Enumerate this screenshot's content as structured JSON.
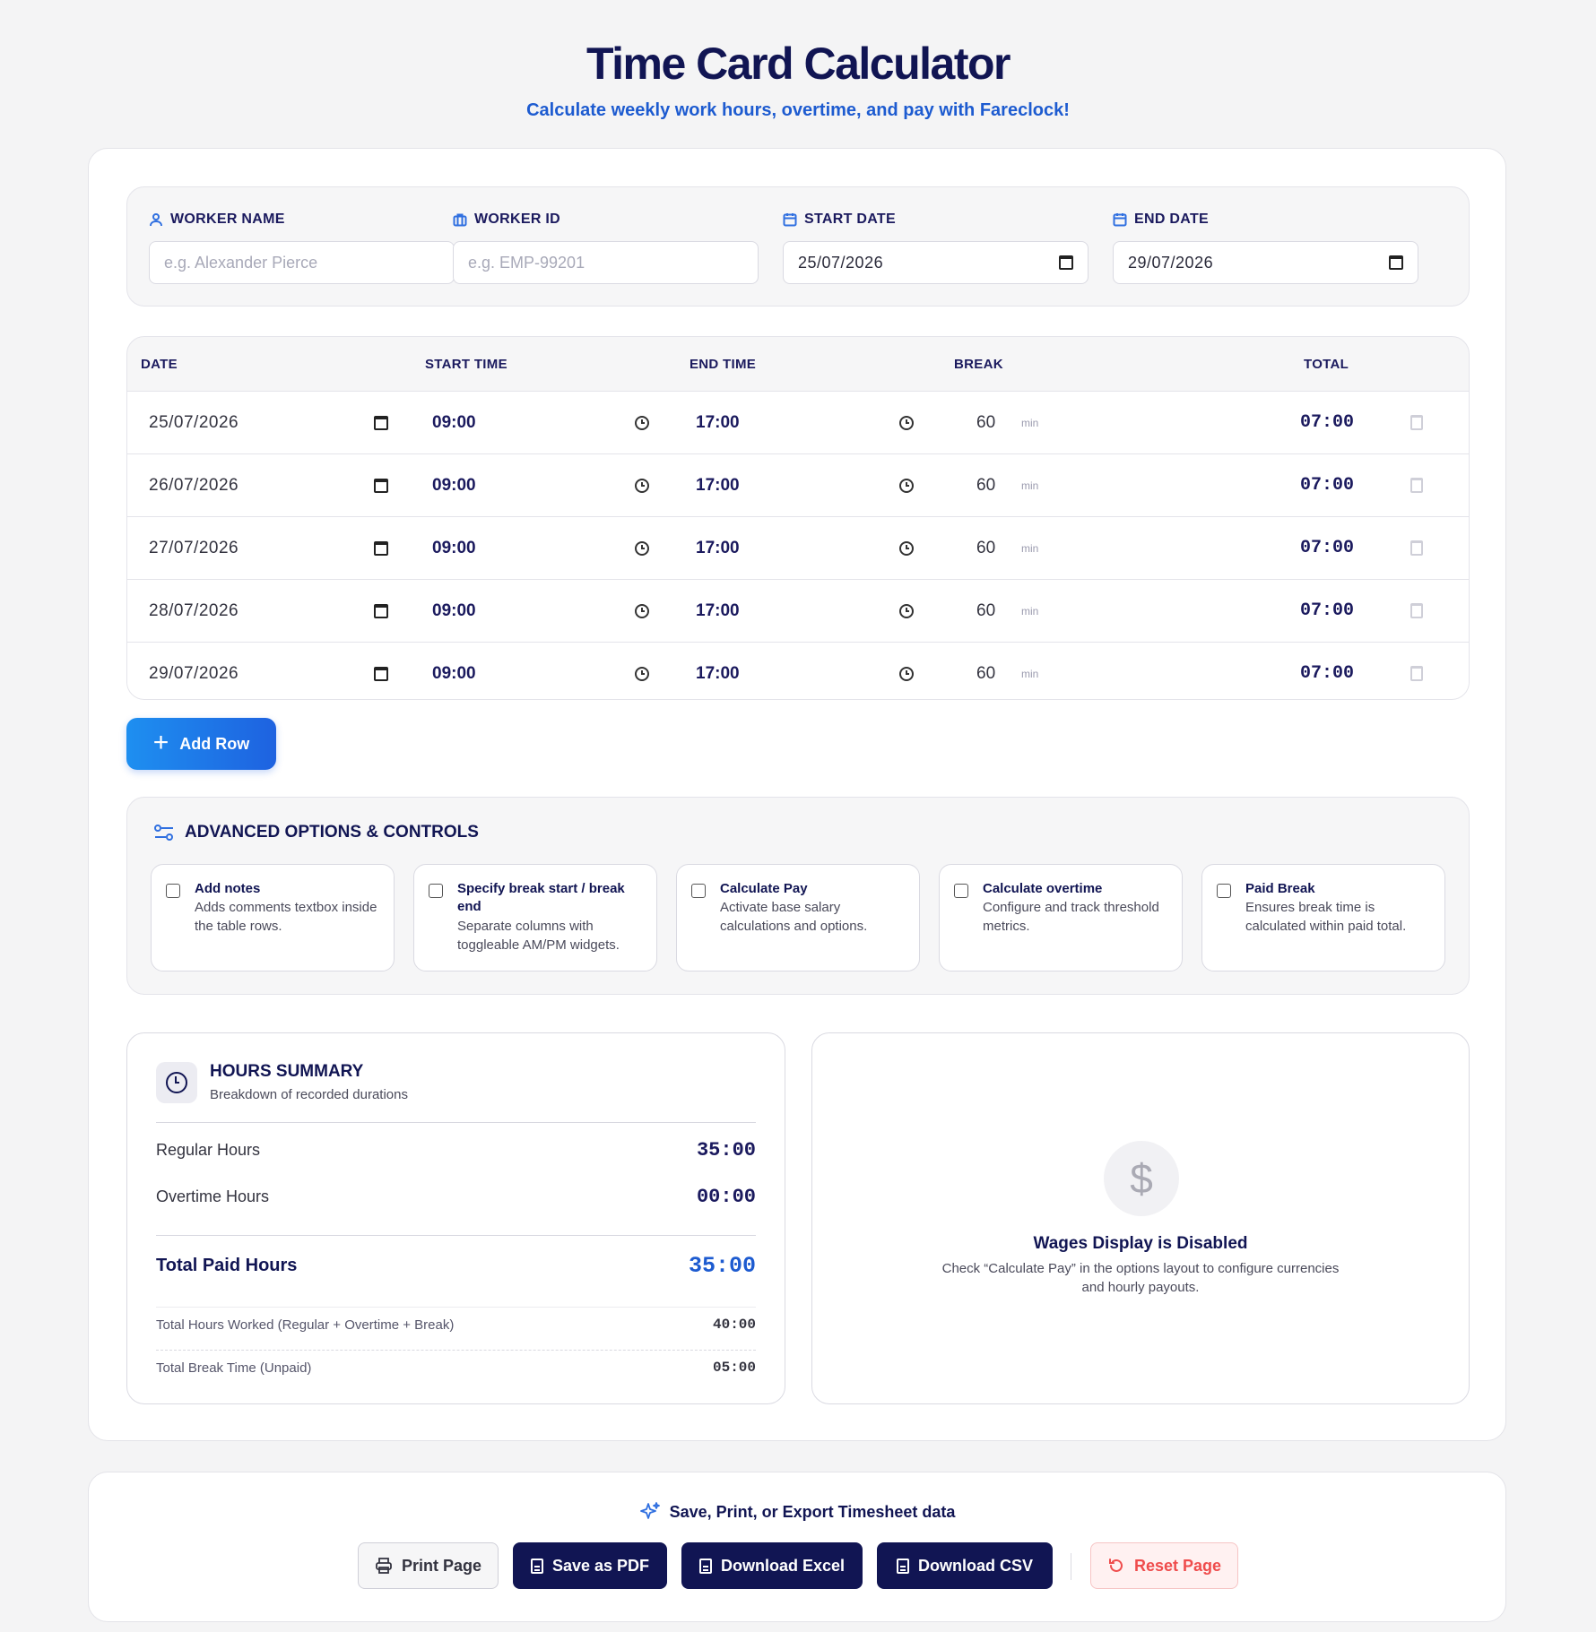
{
  "header": {
    "title": "Time Card Calculator",
    "subtitle": "Calculate weekly work hours, overtime, and pay with Fareclock!"
  },
  "worker": {
    "name_label": "WORKER NAME",
    "name_placeholder": "e.g. Alexander Pierce",
    "id_label": "WORKER ID",
    "id_placeholder": "e.g. EMP-99201",
    "start_label": "START DATE",
    "start_value": "25/07/2026",
    "end_label": "END DATE",
    "end_value": "29/07/2026"
  },
  "table": {
    "headers": {
      "date": "DATE",
      "start": "START TIME",
      "end": "END TIME",
      "break": "BREAK",
      "total": "TOTAL"
    },
    "break_unit": "min",
    "rows": [
      {
        "date": "25/07/2026",
        "start": "09:00",
        "end": "17:00",
        "break": "60",
        "total": "07:00"
      },
      {
        "date": "26/07/2026",
        "start": "09:00",
        "end": "17:00",
        "break": "60",
        "total": "07:00"
      },
      {
        "date": "27/07/2026",
        "start": "09:00",
        "end": "17:00",
        "break": "60",
        "total": "07:00"
      },
      {
        "date": "28/07/2026",
        "start": "09:00",
        "end": "17:00",
        "break": "60",
        "total": "07:00"
      },
      {
        "date": "29/07/2026",
        "start": "09:00",
        "end": "17:00",
        "break": "60",
        "total": "07:00"
      }
    ],
    "add_row_label": "Add Row"
  },
  "advanced": {
    "title": "ADVANCED OPTIONS & CONTROLS",
    "options": [
      {
        "title": "Add notes",
        "desc": "Adds comments textbox inside the table rows.",
        "checked": false
      },
      {
        "title": "Specify break start / break end",
        "desc": "Separate columns with toggleable AM/PM widgets.",
        "checked": false
      },
      {
        "title": "Calculate Pay",
        "desc": "Activate base salary calculations and options.",
        "checked": false
      },
      {
        "title": "Calculate overtime",
        "desc": "Configure and track threshold metrics.",
        "checked": false
      },
      {
        "title": "Paid Break",
        "desc": "Ensures break time is calculated within paid total.",
        "checked": false
      }
    ]
  },
  "summary": {
    "title": "HOURS SUMMARY",
    "subtitle": "Breakdown of recorded durations",
    "regular_label": "Regular Hours",
    "regular_value": "35:00",
    "overtime_label": "Overtime Hours",
    "overtime_value": "00:00",
    "total_paid_label": "Total Paid Hours",
    "total_paid_value": "35:00",
    "worked_label": "Total Hours Worked (Regular + Overtime + Break)",
    "worked_value": "40:00",
    "break_label": "Total Break Time (Unpaid)",
    "break_value": "05:00"
  },
  "wages": {
    "icon": "dollar-icon",
    "title": "Wages Display is Disabled",
    "desc": "Check “Calculate Pay” in the options layout to configure currencies and hourly payouts."
  },
  "footer": {
    "heading": "Save, Print, or Export Timesheet data",
    "print_label": "Print Page",
    "pdf_label": "Save as PDF",
    "excel_label": "Download Excel",
    "csv_label": "Download CSV",
    "reset_label": "Reset Page"
  },
  "colors": {
    "navy": "#111553",
    "accent_blue": "#1d5bd0",
    "add_button_gradient": [
      "#1e8ff0",
      "#1e62e0"
    ],
    "danger": "#ef4c4c"
  }
}
